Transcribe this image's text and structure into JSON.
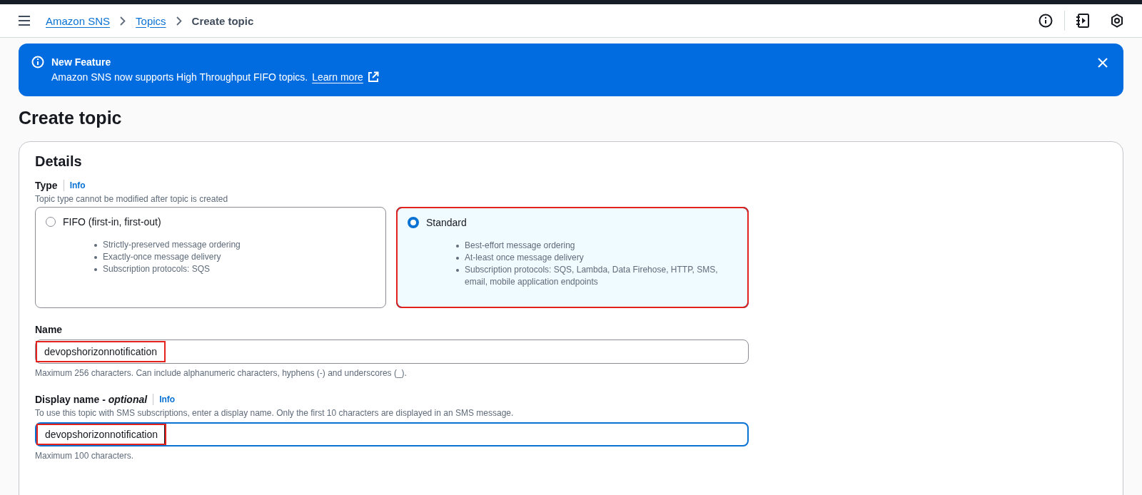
{
  "breadcrumbs": [
    {
      "label": "Amazon SNS",
      "kind": "link"
    },
    {
      "label": "Topics",
      "kind": "link"
    },
    {
      "label": "Create topic",
      "kind": "current"
    }
  ],
  "banner": {
    "title": "New Feature",
    "text": "Amazon SNS now supports High Throughput FIFO topics.",
    "link": "Learn more"
  },
  "page_title": "Create topic",
  "details": {
    "heading": "Details",
    "type": {
      "label": "Type",
      "info": "Info",
      "description": "Topic type cannot be modified after topic is created",
      "options": [
        {
          "label": "FIFO (first-in, first-out)",
          "selected": false,
          "highlighted": false,
          "bullets": [
            "Strictly-preserved message ordering",
            "Exactly-once message delivery",
            "Subscription protocols: SQS"
          ]
        },
        {
          "label": "Standard",
          "selected": true,
          "highlighted": true,
          "bullets": [
            "Best-effort message ordering",
            "At-least once message delivery",
            "Subscription protocols: SQS, Lambda, Data Firehose, HTTP, SMS, email, mobile application endpoints"
          ]
        }
      ]
    },
    "name": {
      "label": "Name",
      "value": "devopshorizonnotification",
      "focused": false,
      "highlighted": true,
      "hint": "Maximum 256 characters. Can include alphanumeric characters, hyphens (-) and underscores (_)."
    },
    "display_name": {
      "label": "Display name - *optional*",
      "info": "Info",
      "description": "To use this topic with SMS subscriptions, enter a display name. Only the first 10 characters are displayed in an SMS message.",
      "value": "devopshorizonnotification",
      "focused": true,
      "highlighted": true,
      "hint": "Maximum 100 characters."
    }
  }
}
